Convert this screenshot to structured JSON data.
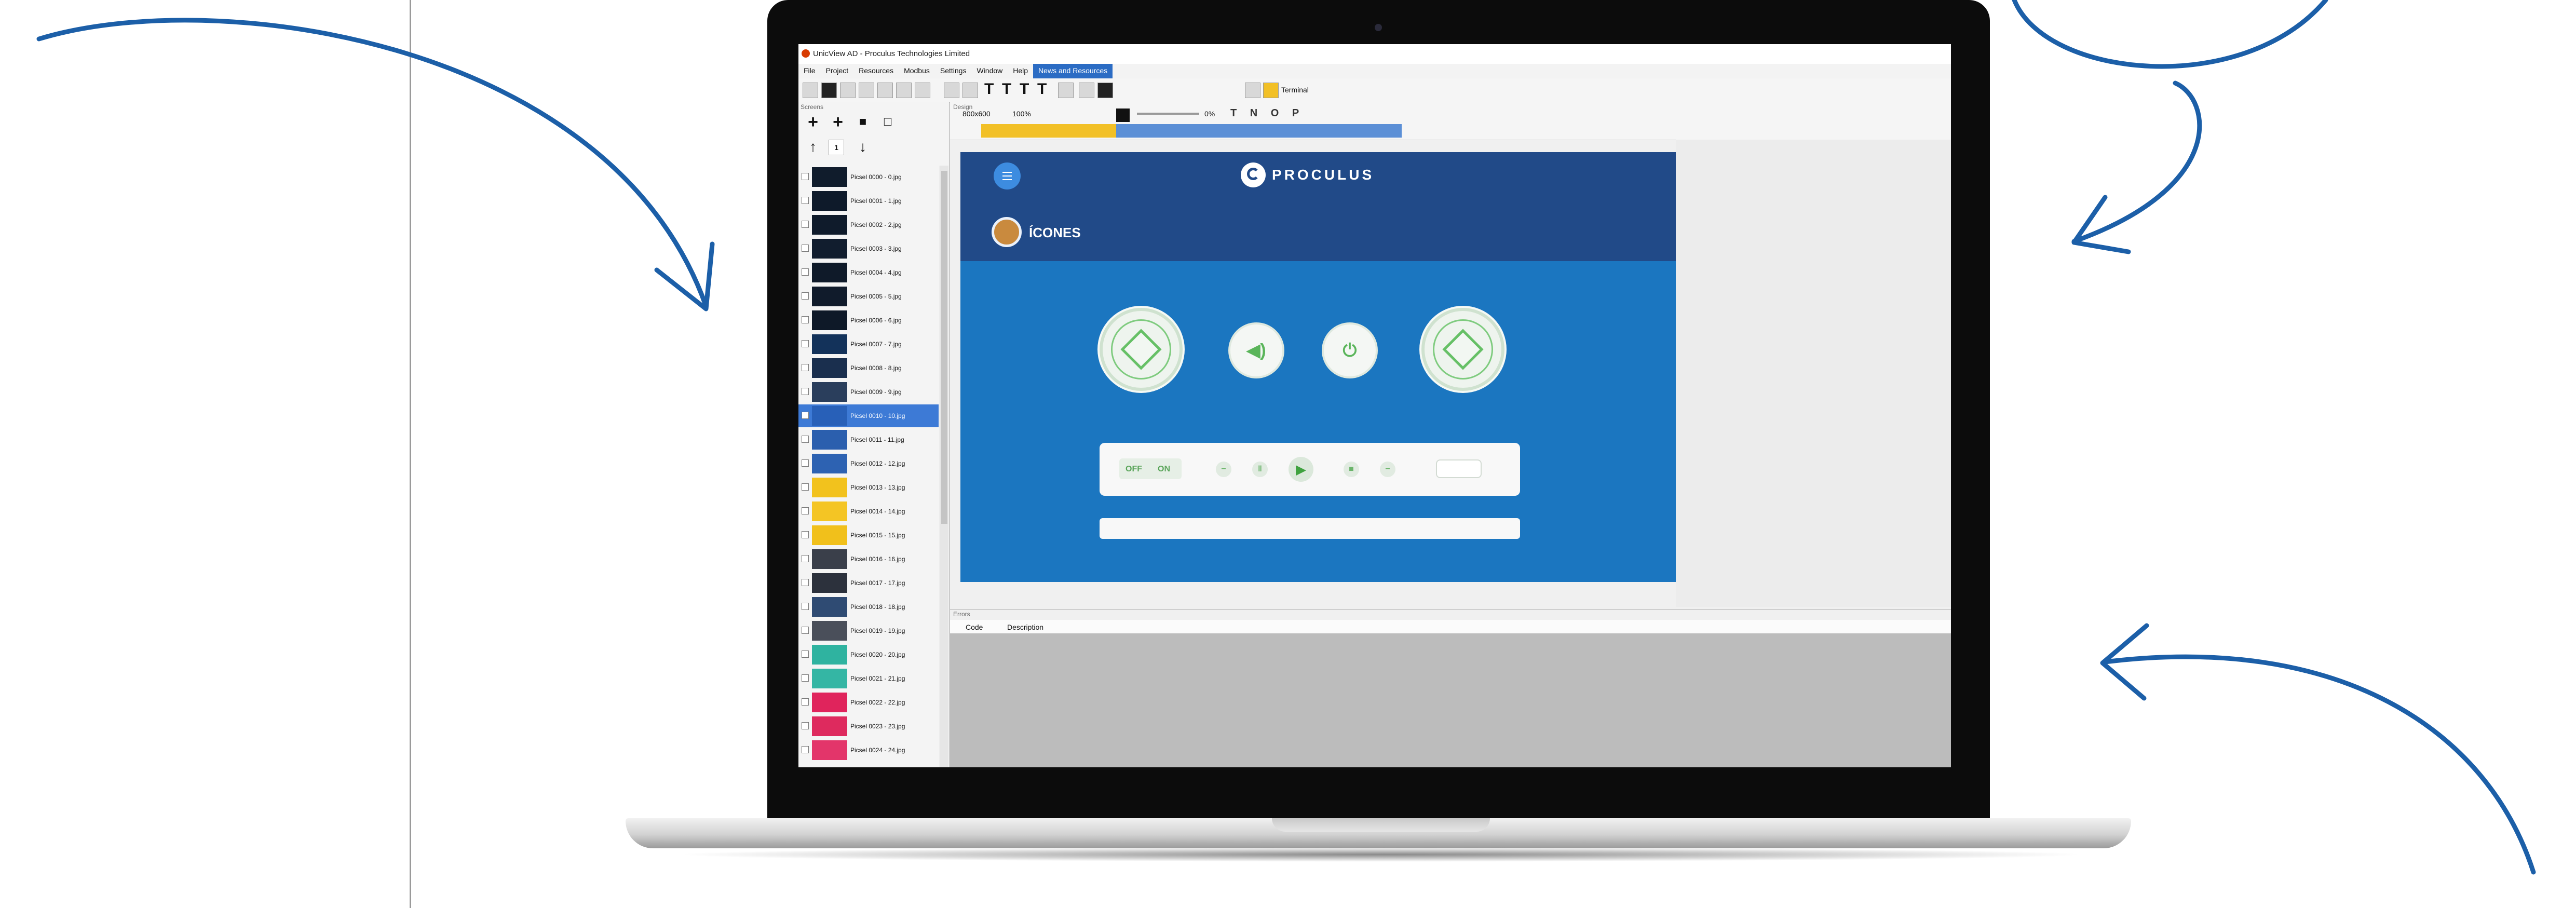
{
  "colors": {
    "arrow": "#1c5fa8",
    "canvas_header": "#214a88",
    "canvas_body": "#1b76c0",
    "accent_green": "#5ab55a",
    "selected_row": "#3d7ad6",
    "active_menu": "#2b6cc4"
  },
  "window": {
    "title": "UnicView AD - Proculus Technologies Limited"
  },
  "menu": [
    "File",
    "Project",
    "Resources",
    "Modbus",
    "Settings",
    "Window",
    "Help",
    "News and Resources"
  ],
  "toolbar": {
    "terminal_label": "Terminal"
  },
  "left_panel": {
    "label": "Screens",
    "page_number": "1",
    "screens": [
      {
        "label": "Picsel 0000 - 0.jpg",
        "thumb": "#101c2c"
      },
      {
        "label": "Picsel 0001 - 1.jpg",
        "thumb": "#0e1a2a"
      },
      {
        "label": "Picsel 0002 - 2.jpg",
        "thumb": "#0f1b2b"
      },
      {
        "label": "Picsel 0003 - 3.jpg",
        "thumb": "#111d2e"
      },
      {
        "label": "Picsel 0004 - 4.jpg",
        "thumb": "#0f1a29"
      },
      {
        "label": "Picsel 0005 - 5.jpg",
        "thumb": "#101b2b"
      },
      {
        "label": "Picsel 0006 - 6.jpg",
        "thumb": "#0e1928"
      },
      {
        "label": "Picsel 0007 - 7.jpg",
        "thumb": "#13325a"
      },
      {
        "label": "Picsel 0008 - 8.jpg",
        "thumb": "#1a2f4e"
      },
      {
        "label": "Picsel 0009 - 9.jpg",
        "thumb": "#2a3e5c"
      },
      {
        "label": "Picsel 0010 - 10.jpg",
        "thumb": "#2860b8"
      },
      {
        "label": "Picsel 0011 - 11.jpg",
        "thumb": "#2b5fae"
      },
      {
        "label": "Picsel 0012 - 12.jpg",
        "thumb": "#2d62b2"
      },
      {
        "label": "Picsel 0013 - 13.jpg",
        "thumb": "#f2c21d"
      },
      {
        "label": "Picsel 0014 - 14.jpg",
        "thumb": "#f4c524"
      },
      {
        "label": "Picsel 0015 - 15.jpg",
        "thumb": "#f1c01b"
      },
      {
        "label": "Picsel 0016 - 16.jpg",
        "thumb": "#3a3f4a"
      },
      {
        "label": "Picsel 0017 - 17.jpg",
        "thumb": "#2c313c"
      },
      {
        "label": "Picsel 0018 - 18.jpg",
        "thumb": "#2f4b73"
      },
      {
        "label": "Picsel 0019 - 19.jpg",
        "thumb": "#4a4f5a"
      },
      {
        "label": "Picsel 0020 - 20.jpg",
        "thumb": "#2fb3a0"
      },
      {
        "label": "Picsel 0021 - 21.jpg",
        "thumb": "#34b6a4"
      },
      {
        "label": "Picsel 0022 - 22.jpg",
        "thumb": "#e0245c"
      },
      {
        "label": "Picsel 0023 - 23.jpg",
        "thumb": "#de2a5e"
      },
      {
        "label": "Picsel 0024 - 24.jpg",
        "thumb": "#e3356a"
      }
    ],
    "selected_index": 10
  },
  "design": {
    "label": "Design",
    "resolution": "800x600",
    "zoom": "100%",
    "percent": "0%",
    "tnop": "T N O P"
  },
  "canvas": {
    "logo": "PROCULUS",
    "section_title": "ÍCONES",
    "toggle_off": "OFF",
    "toggle_on": "ON",
    "play_icon": "▶",
    "stop_icon": "■"
  },
  "output_panel": {
    "label": "Errors",
    "columns": [
      "Code",
      "Description"
    ]
  }
}
